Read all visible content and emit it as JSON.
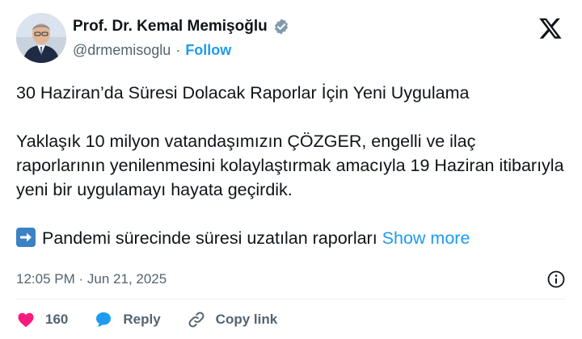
{
  "author": {
    "name": "Prof. Dr. Kemal Memişoğlu",
    "handle": "@drmemisoglu",
    "separator": "·",
    "follow_label": "Follow",
    "verified_icon": "verified-badge-icon",
    "verified_color": "#829aab"
  },
  "brand": {
    "logo": "x-logo-icon"
  },
  "tweet": {
    "paragraphs": [
      "30 Haziran’da Süresi Dolacak Raporlar İçin Yeni Uygulama",
      "Yaklaşık 10 milyon vatandaşımızın ÇÖZGER, engelli ve ilaç raporlarının yenilenmesini kolaylaştırmak amacıyla 19 Haziran itibarıyla yeni bir uygulamayı hayata geçirdik."
    ],
    "teaser": "Pandemi sürecinde süresi uzatılan raporları",
    "teaser_emoji": "arrow-right-emoji-icon",
    "show_more": "Show more"
  },
  "meta": {
    "time": "12:05 PM",
    "separator": "·",
    "date": "Jun 21, 2025",
    "info_icon": "info-icon"
  },
  "actions": {
    "likes": "160",
    "reply_label": "Reply",
    "copy_link_label": "Copy link"
  },
  "colors": {
    "accent": "#1d9bf0",
    "heart": "#f91880",
    "reply_bubble": "#1d9bf0",
    "text": "#0f1419",
    "muted": "#536471"
  }
}
